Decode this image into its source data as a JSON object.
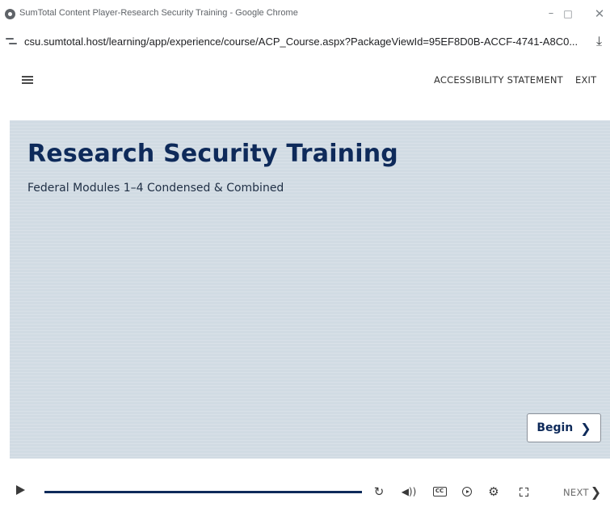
{
  "window": {
    "title": "SumTotal Content Player-Research Security Training - Google Chrome",
    "minimize_glyph": "–",
    "maximize_glyph": "□",
    "close_glyph": "✕"
  },
  "addressbar": {
    "url": "csu.sumtotal.host/learning/app/experience/course/ACP_Course.aspx?PackageViewId=95EF8D0B-ACCF-4741-A8C0..."
  },
  "header": {
    "accessibility_label": "ACCESSIBILITY STATEMENT",
    "exit_label": "EXIT"
  },
  "slide": {
    "title": "Research Security Training",
    "subtitle": "Federal Modules 1–4 Condensed & Combined",
    "begin_label": "Begin",
    "begin_chevron": "❯"
  },
  "player": {
    "progress": 1.0,
    "cc_label": "CC",
    "next_label": "NEXT",
    "next_chevron": "❯"
  },
  "colors": {
    "brand_navy": "#0e2a5a",
    "slide_background": "#d1dbe3"
  },
  "icons": [
    "chrome-icon",
    "site-info-icon",
    "download-icon",
    "hamburger-menu-icon",
    "play-icon",
    "replay-icon",
    "volume-icon",
    "cc-icon",
    "playback-speed-icon",
    "gear-icon",
    "fullscreen-icon",
    "chevron-right-icon"
  ]
}
